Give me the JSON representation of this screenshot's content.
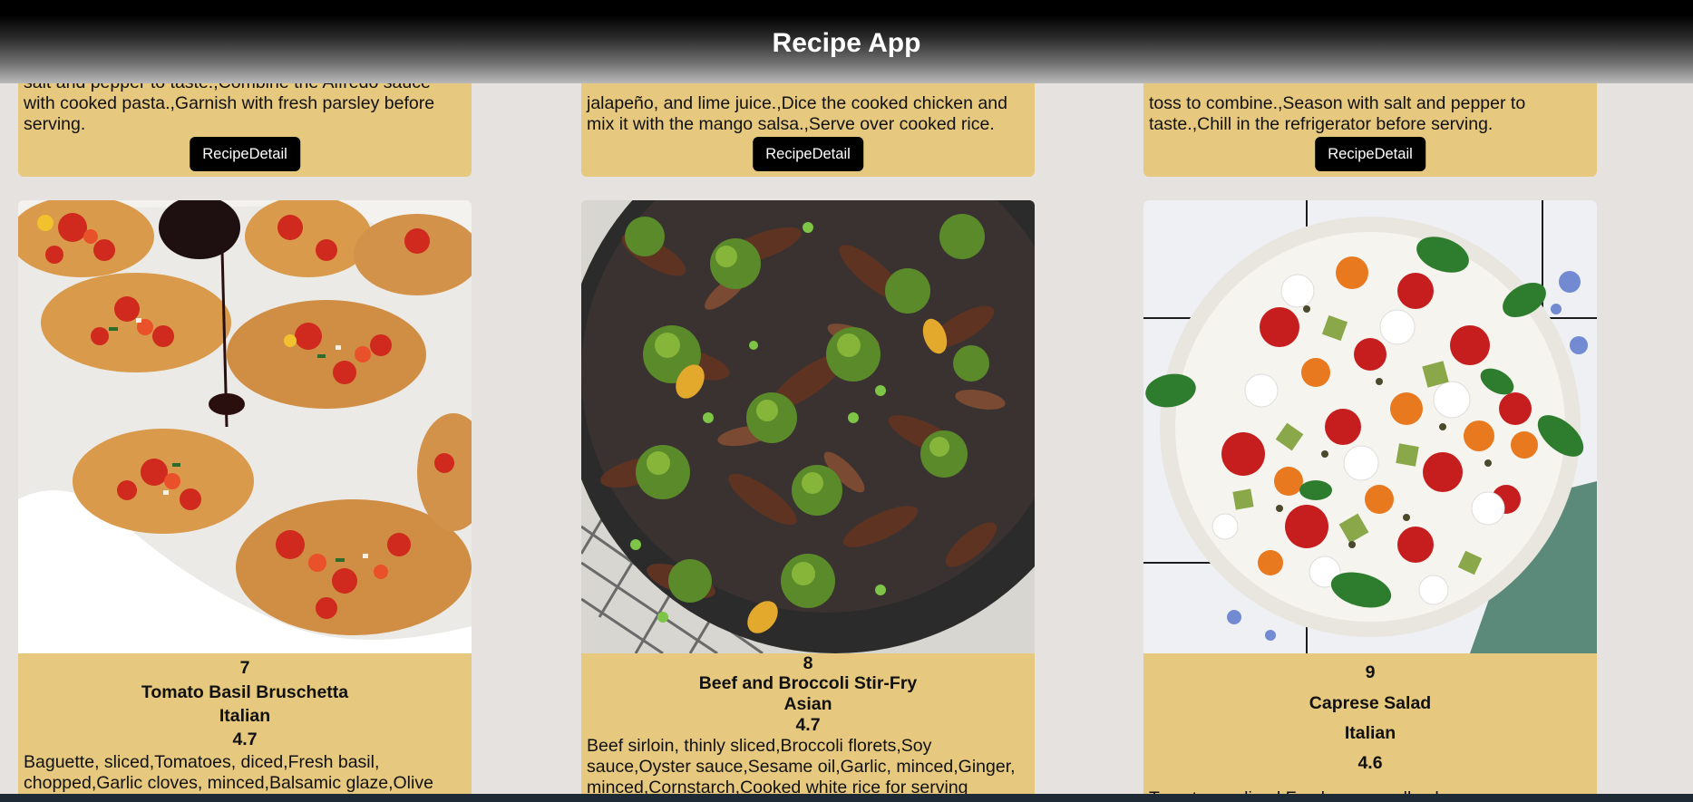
{
  "app": {
    "title": "Recipe App"
  },
  "top_cards": [
    {
      "steps": "salt and pepper to taste.,Combine the Alfredo sauce with cooked pasta.,Garnish with fresh parsley before serving.",
      "button": "RecipeDetail"
    },
    {
      "steps": "jalapeño, and lime juice.,Dice the cooked chicken and mix it with the mango salsa.,Serve over cooked rice.",
      "button": "RecipeDetail"
    },
    {
      "steps": "toss to combine.,Season with salt and pepper to taste.,Chill in the refrigerator before serving.",
      "button": "RecipeDetail"
    }
  ],
  "recipes": [
    {
      "id": "7",
      "name": "Tomato Basil Bruschetta",
      "cuisine": "Italian",
      "rating": "4.7",
      "ingredients": "Baguette, sliced,Tomatoes, diced,Fresh basil, chopped,Garlic cloves, minced,Balsamic glaze,Olive"
    },
    {
      "id": "8",
      "name": "Beef and Broccoli Stir-Fry",
      "cuisine": "Asian",
      "rating": "4.7",
      "ingredients": "Beef sirloin, thinly sliced,Broccoli florets,Soy sauce,Oyster sauce,Sesame oil,Garlic, minced,Ginger, minced,Cornstarch,Cooked white rice for serving"
    },
    {
      "id": "9",
      "name": "Caprese Salad",
      "cuisine": "Italian",
      "rating": "4.6",
      "ingredients": "Tomatoes, sliced,Fresh mozzarella cheese"
    }
  ],
  "colors": {
    "card_background": "#e6c97e",
    "page_background": "#e5e2e0",
    "button_background": "#000000",
    "header_background": "#000000"
  }
}
